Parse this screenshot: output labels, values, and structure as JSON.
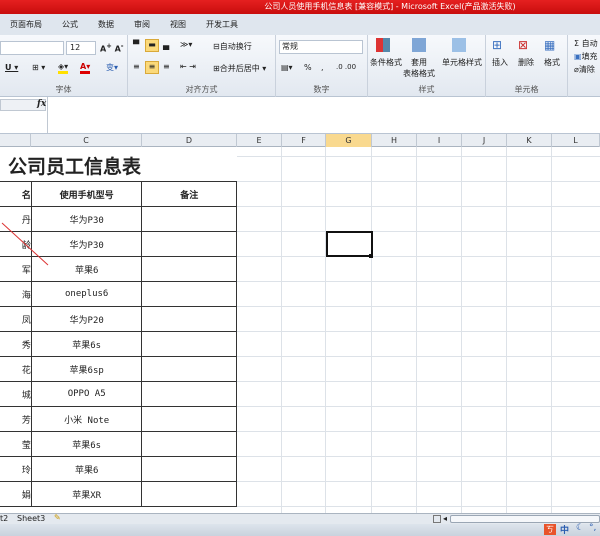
{
  "title": "公司人员使用手机信息表  [兼容模式] - Microsoft Excel(产品激活失败)",
  "menu": [
    "页面布局",
    "公式",
    "数据",
    "审阅",
    "视图",
    "开发工具"
  ],
  "ribbon": {
    "font_size": "12",
    "font_group": "字体",
    "align_group": "对齐方式",
    "number_group": "数字",
    "styles_group": "样式",
    "cells_group": "单元格",
    "wrap_text": "自动换行",
    "merge_center": "合并后居中",
    "number_format": "常规",
    "percent": "%",
    "comma": ",",
    "cond_format": "条件格式",
    "table_format": "套用\n表格格式",
    "cell_styles": "单元格样式",
    "insert": "插入",
    "delete": "删除",
    "format": "格式",
    "autosum": "Σ 自动",
    "fill": "填充",
    "clear": "清除"
  },
  "formula": {
    "fx": "fx",
    "value": ""
  },
  "columns": [
    "C",
    "D",
    "E",
    "F",
    "G",
    "H",
    "I",
    "J",
    "K",
    "L"
  ],
  "active_column": "G",
  "sheet": {
    "title": "公司员工信息表",
    "headers": [
      "名",
      "使用手机型号",
      "备注"
    ],
    "rows": [
      [
        "丹",
        "华为P30",
        ""
      ],
      [
        "龄",
        "华为P30",
        ""
      ],
      [
        "军",
        "苹果6",
        ""
      ],
      [
        "海",
        "oneplus6",
        ""
      ],
      [
        "凤",
        "华为P20",
        ""
      ],
      [
        "秀",
        "苹果6s",
        ""
      ],
      [
        "花",
        "苹果6sp",
        ""
      ],
      [
        "城",
        "OPPO A5",
        ""
      ],
      [
        "芳",
        "小米  Note",
        ""
      ],
      [
        "莹",
        "苹果6s",
        ""
      ],
      [
        "玲",
        "苹果6",
        ""
      ],
      [
        "娟",
        "苹果XR",
        ""
      ]
    ]
  },
  "sheet_tabs": [
    "t2",
    "Sheet3"
  ],
  "ime": "中"
}
